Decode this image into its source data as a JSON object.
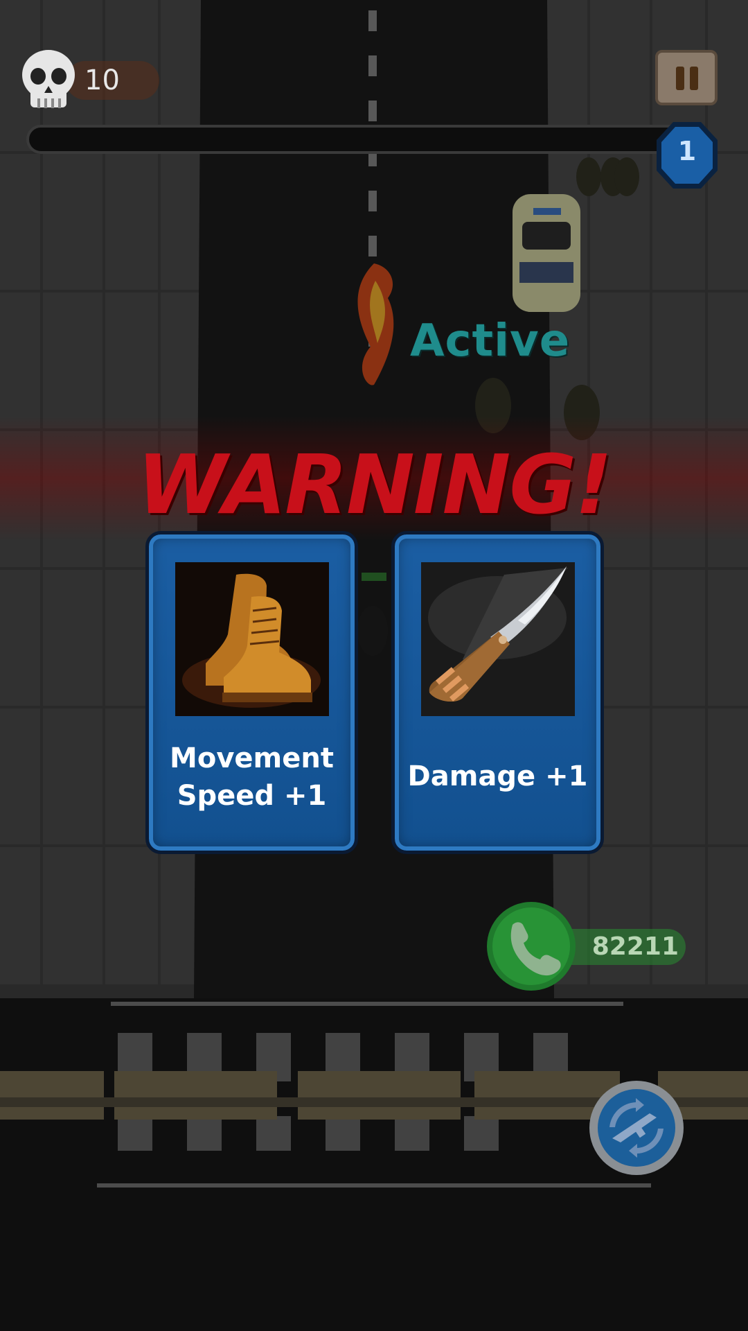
{
  "hud": {
    "kills": "10",
    "level": "1",
    "progress": 0.0
  },
  "status": {
    "active_label": "Active",
    "warning": "WARNING!"
  },
  "upgrades": [
    {
      "label_line1": "Movement",
      "label_line2": "Speed +1",
      "icon": "boots-icon"
    },
    {
      "label": "Damage +1",
      "icon": "knife-icon"
    }
  ],
  "currency": {
    "amount": "82211",
    "icon": "phone-icon"
  },
  "buttons": {
    "pause_icon": "pause-icon",
    "weapon_swap_icon": "weapon-swap-icon"
  },
  "colors": {
    "card_blue": "#1b5ea3",
    "warning_red": "#c8101a",
    "active_teal": "#1f8c8c",
    "phone_green": "#2fa046"
  }
}
